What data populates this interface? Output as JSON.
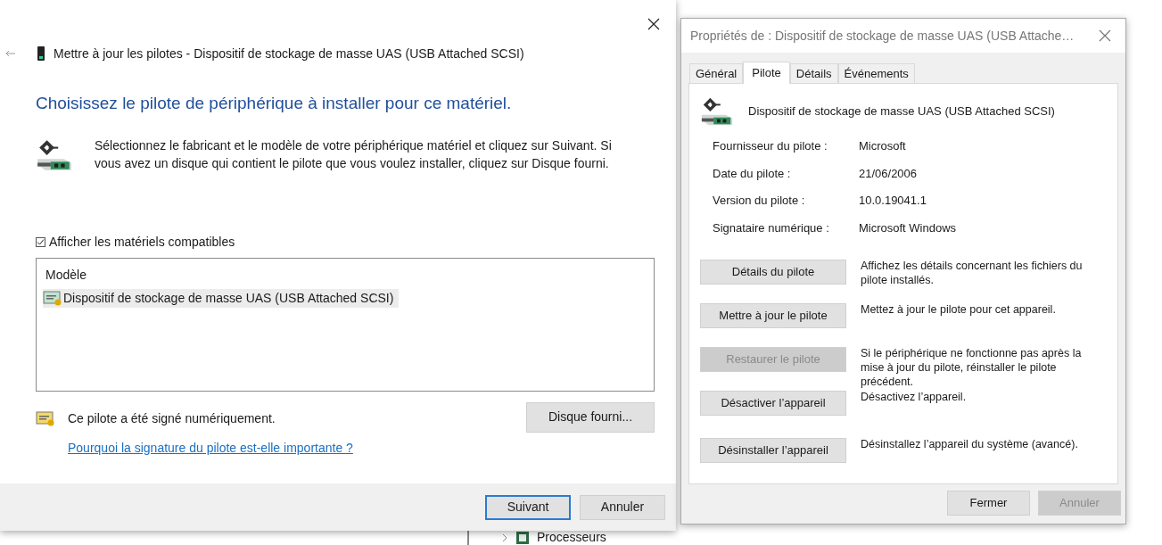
{
  "background_window": {
    "tree_items": [
      {
        "label": "Processeurs"
      }
    ]
  },
  "update_dialog": {
    "title": "Mettre à jour les pilotes - Dispositif de stockage de masse UAS (USB Attached SCSI)",
    "heading": "Choisissez le pilote de périphérique à installer pour ce matériel.",
    "instructions": "Sélectionnez le fabricant et le modèle de votre périphérique matériel et cliquez sur Suivant. Si vous avez un disque qui contient le pilote que vous voulez installer, cliquez sur Disque fourni.",
    "show_compatible": {
      "label": "Afficher les matériels compatibles",
      "checked": true
    },
    "model_list": {
      "header": "Modèle",
      "items": [
        {
          "label": "Dispositif de stockage de masse UAS (USB Attached SCSI)",
          "selected": true
        }
      ]
    },
    "signature": {
      "text": "Ce pilote a été signé numériquement.",
      "link": "Pourquoi la signature du pilote est-elle importante ?"
    },
    "have_disk_button": "Disque fourni...",
    "buttons": [
      {
        "label": "Suivant",
        "default": true
      },
      {
        "label": "Annuler",
        "default": false
      }
    ]
  },
  "properties_dialog": {
    "title": "Propriétés de : Dispositif de stockage de masse UAS (USB Attache…",
    "tabs": [
      {
        "label": "Général",
        "selected": false
      },
      {
        "label": "Pilote",
        "selected": true
      },
      {
        "label": "Détails",
        "selected": false
      },
      {
        "label": "Événements",
        "selected": false
      }
    ],
    "device_name": "Dispositif de stockage de masse UAS (USB Attached SCSI)",
    "properties": [
      {
        "label": "Fournisseur du pilote :",
        "value": "Microsoft"
      },
      {
        "label": "Date du pilote :",
        "value": "21/06/2006"
      },
      {
        "label": "Version du pilote :",
        "value": "10.0.19041.1"
      },
      {
        "label": "Signataire numérique :",
        "value": "Microsoft Windows"
      }
    ],
    "actions": [
      {
        "button": "Détails du pilote",
        "description": "Affichez les détails concernant les fichiers du pilote installés.",
        "disabled": false
      },
      {
        "button": "Mettre à jour le pilote",
        "description": "Mettez à jour le pilote pour cet appareil.",
        "disabled": false
      },
      {
        "button": "Restaurer le pilote",
        "description": "Si le périphérique ne fonctionne pas après la mise à jour du pilote, réinstaller le pilote précédent.",
        "disabled": true
      },
      {
        "button": "Désactiver l’appareil",
        "description": "Désactivez l’appareil.",
        "disabled": false
      },
      {
        "button": "Désinstaller l’appareil",
        "description": "Désinstallez l’appareil du système (avancé).",
        "disabled": false
      }
    ],
    "buttons": [
      {
        "label": "Fermer",
        "disabled": false
      },
      {
        "label": "Annuler",
        "disabled": true
      }
    ]
  }
}
